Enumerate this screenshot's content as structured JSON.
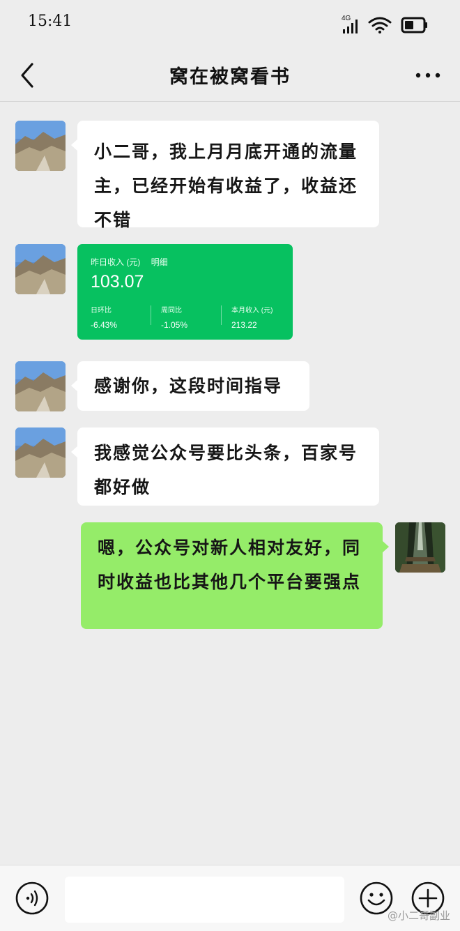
{
  "status_bar": {
    "time": "15:41",
    "network": "4G"
  },
  "header": {
    "title": "窝在被窝看书"
  },
  "messages": [
    {
      "text": "小二哥，我上月月底开通的流量主，已经开始有收益了，收益还不错"
    },
    {
      "card": {
        "label": "昨日收入 (元)",
        "detail_link": "明细",
        "amount": "103.07",
        "stats": [
          {
            "label": "日环比",
            "value": "-6.43%"
          },
          {
            "label": "周同比",
            "value": "-1.05%"
          },
          {
            "label": "本月收入 (元)",
            "value": "213.22"
          }
        ]
      }
    },
    {
      "text": "感谢你，这段时间指导"
    },
    {
      "text": "我感觉公众号要比头条，百家号都好做"
    },
    {
      "text": "嗯，公众号对新人相对友好，同时收益也比其他几个平台要强点"
    }
  ],
  "watermark": "@小二哥副业",
  "colors": {
    "background": "#ededed",
    "bubble_incoming": "#ffffff",
    "bubble_outgoing": "#95ec69",
    "income_card": "#07c160"
  },
  "icons": {
    "back": "chevron-left-icon",
    "more": "more-dots-icon",
    "voice": "voice-icon",
    "emoji": "emoji-icon",
    "plus": "plus-icon"
  }
}
